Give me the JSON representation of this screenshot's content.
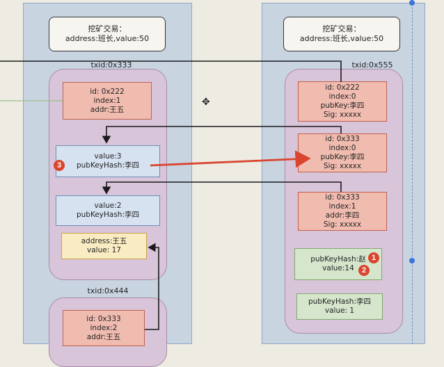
{
  "left": {
    "note": [
      "挖矿交易：",
      "address:班长,value:50"
    ],
    "tx1": {
      "label": "txid:0x333",
      "input": [
        "id: 0x222",
        "index:1",
        "addr:王五"
      ],
      "output1": [
        "value:3",
        "pubKeyHash:李四"
      ],
      "output2": [
        "value:2",
        "pubKeyHash:李四"
      ],
      "output3": [
        "address:王五",
        "value: 17"
      ]
    },
    "tx2": {
      "label": "txid:0x444",
      "input": [
        "id: 0x333",
        "index:2",
        "addr:王五"
      ]
    }
  },
  "right": {
    "note": [
      "挖矿交易：",
      "address:班长,value:50"
    ],
    "tx": {
      "label": "txid:0x555",
      "input1": [
        "id: 0x222",
        "index:0",
        "pubKey:李四",
        "Sig: xxxxx"
      ],
      "input2": [
        "id: 0x333",
        "index:0",
        "pubKey:李四",
        "Sig: xxxxx"
      ],
      "input3": [
        "id: 0x333",
        "index:1",
        "addr:李四",
        "Sig: xxxxx"
      ],
      "output1": [
        "pubKeyHash:赵",
        "value:14"
      ],
      "output2": [
        "pubKeyHash:李四",
        "value: 1"
      ]
    }
  },
  "badges": [
    "3",
    "1",
    "2"
  ],
  "colors": {
    "arrow": "#d9452e",
    "connector": "#1a1a1a",
    "lane": "#c9d4e1",
    "group": "#d8c5d9"
  }
}
